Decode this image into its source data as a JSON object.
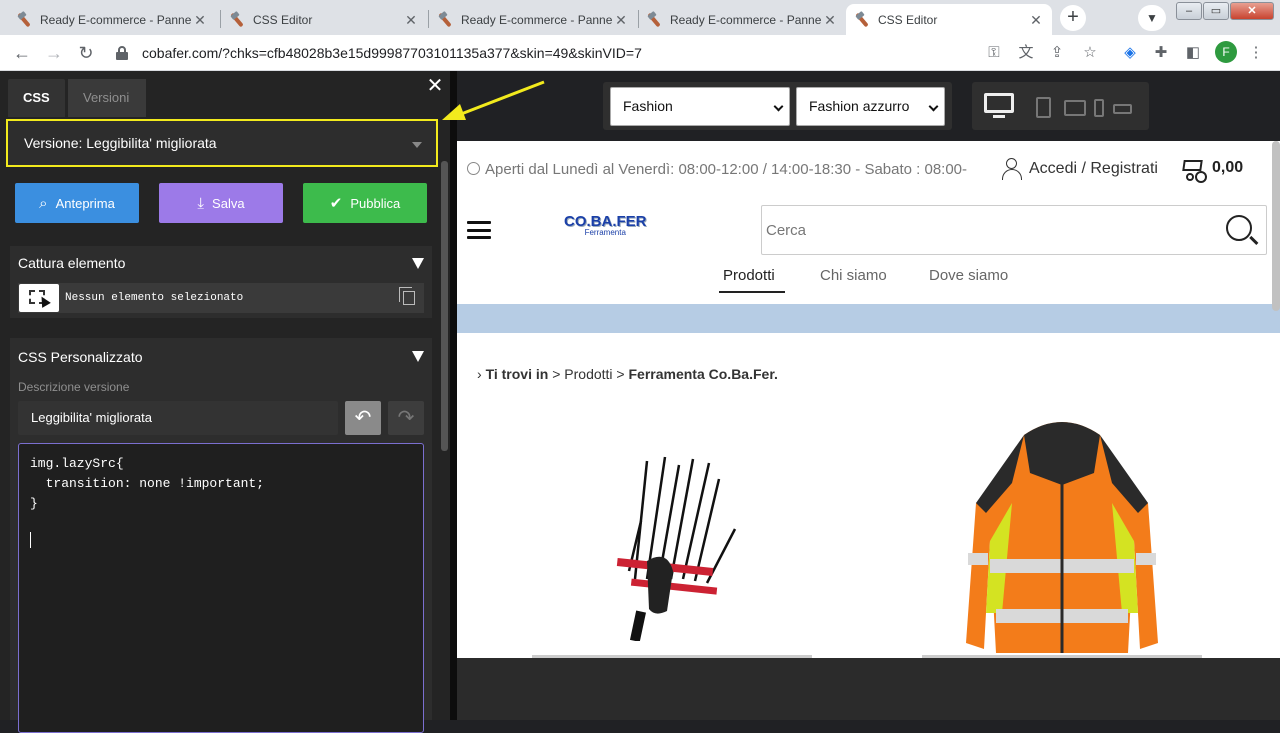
{
  "browser": {
    "tabs": [
      {
        "title": "Ready E-commerce - Pannello",
        "active": false
      },
      {
        "title": "CSS Editor",
        "active": false
      },
      {
        "title": "Ready E-commerce - Pannello",
        "active": false
      },
      {
        "title": "Ready E-commerce - Pannello",
        "active": false
      },
      {
        "title": "CSS Editor",
        "active": true
      }
    ],
    "url": "cobafer.com/?chks=cfb48028b3e15d99987703101135a377&skin=49&skinVID=7",
    "profile_initial": "F"
  },
  "editor": {
    "tabs": [
      "CSS",
      "Versioni"
    ],
    "version_select": "Versione: Leggibilita' migliorata",
    "buttons": {
      "preview": "Anteprima",
      "save": "Salva",
      "publish": "Pubblica"
    },
    "capture": {
      "title": "Cattura elemento",
      "status": "Nessun elemento selezionato"
    },
    "custom_css": {
      "title": "CSS Personalizzato",
      "description_label": "Descrizione versione",
      "description_value": "Leggibilita' migliorata",
      "code": "img.lazySrc{\n  transition: none !important;\n}"
    }
  },
  "preview": {
    "skin_select": "Fashion",
    "color_select": "Fashion azzurro",
    "site": {
      "hours": "Aperti dal Lunedì al Venerdì: 08:00-12:00 / 14:00-18:30 - Sabato : 08:00-",
      "login": "Accedi / Registrati",
      "cart_total": "0,00",
      "logo_main": "CO.BA.FER",
      "logo_sub": "Ferramenta",
      "search_placeholder": "Cerca",
      "menu": [
        "Prodotti",
        "Chi siamo",
        "Dove siamo"
      ],
      "breadcrumb": {
        "label": "Ti trovi in",
        "items": [
          "Prodotti",
          "Ferramenta Co.Ba.Fer."
        ]
      }
    }
  },
  "colors": {
    "highlight": "#f2ea1d",
    "preview_button": "#3b8fe0",
    "save_button": "#9c7ae8",
    "publish_button": "#3dbb4c",
    "banner": "#b6cce4"
  }
}
